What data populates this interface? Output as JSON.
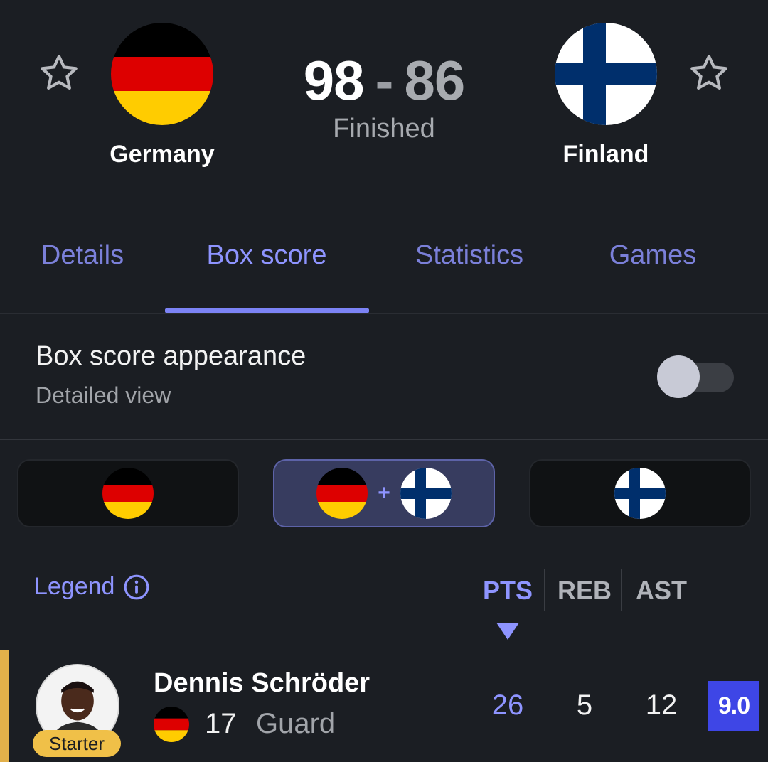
{
  "match": {
    "home_team": "Germany",
    "away_team": "Finland",
    "home_score": "98",
    "separator": "-",
    "away_score": "86",
    "status": "Finished"
  },
  "tabs": [
    {
      "label": "Details"
    },
    {
      "label": "Box score"
    },
    {
      "label": "Statistics"
    },
    {
      "label": "Games"
    }
  ],
  "active_tab": "Box score",
  "appearance": {
    "title": "Box score appearance",
    "subtitle": "Detailed view",
    "toggle_on": false
  },
  "filters": {
    "options": [
      "Germany",
      "Germany + Finland",
      "Finland"
    ],
    "selected": "Germany + Finland",
    "plus_symbol": "+"
  },
  "legend": {
    "label": "Legend"
  },
  "columns": [
    "PTS",
    "REB",
    "AST"
  ],
  "sort_column": "PTS",
  "player": {
    "name": "Dennis Schröder",
    "number": "17",
    "position": "Guard",
    "badge": "Starter",
    "pts": "26",
    "reb": "5",
    "ast": "12",
    "rating": "9.0"
  },
  "colors": {
    "accent": "#8e94ff",
    "background": "#1b1e23",
    "rating_bg": "#3e46e6",
    "starter_badge": "#f0c048"
  },
  "icons": [
    "star-outline-icon",
    "info-icon",
    "sort-down-caret-icon"
  ]
}
